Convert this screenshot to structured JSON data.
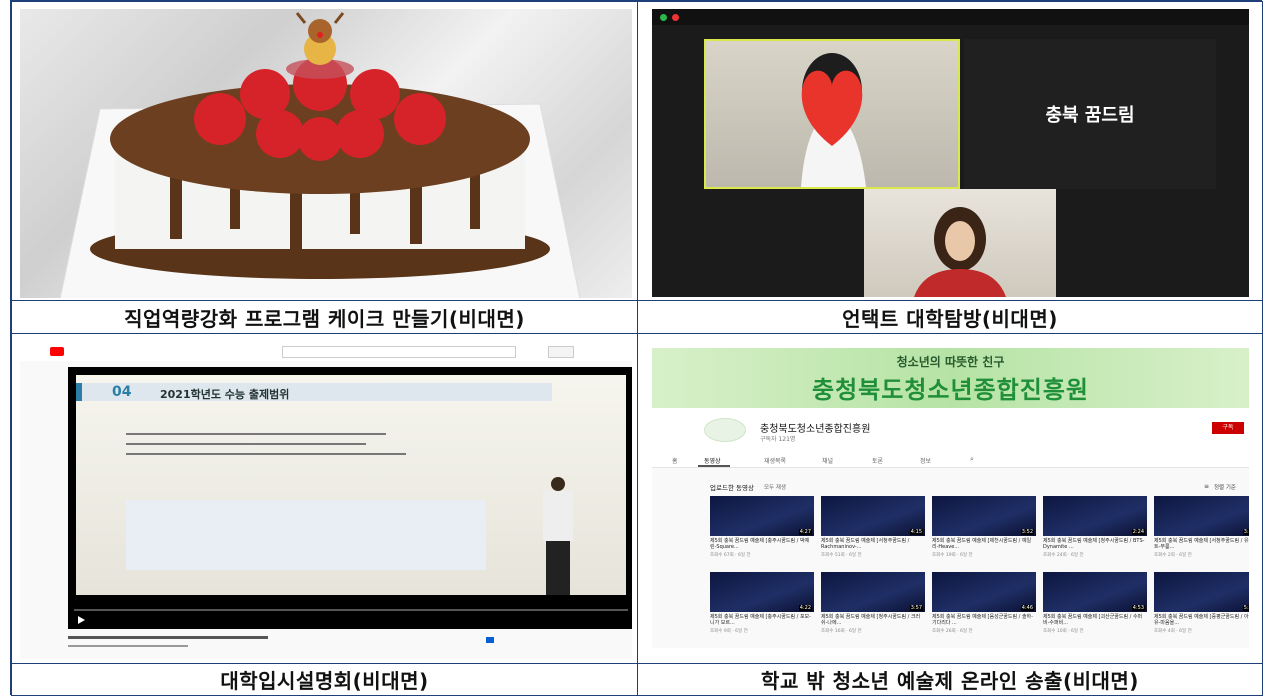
{
  "captions": {
    "top_left": "직업역량강화 프로그램 케이크 만들기(비대면)",
    "top_right": "언택트 대학탐방(비대면)",
    "bottom_left": "대학입시설명회(비대면)",
    "bottom_right": "학교 밖 청소년 예술제 온라인 송출(비대면)"
  },
  "zoom": {
    "participant_name": "충북 꿈드림"
  },
  "youtube": {
    "slide_number": "04",
    "slide_title": "2021학년도 수능 출제범위"
  },
  "site": {
    "banner_subtitle": "청소년의 따뜻한 친구",
    "banner_title": "충청북도청소년종합진흥원",
    "channel_name": "충청북도청소년종합진흥원",
    "subscribers": "구독자 121명",
    "subscribe_label": "구독",
    "tabs": [
      "홈",
      "동영상",
      "재생목록",
      "채널",
      "토론",
      "정보"
    ],
    "section_title": "업로드한 동영상",
    "play_all": "모두 재생",
    "sort_label": "정렬 기준",
    "videos": [
      {
        "title": "제5회 충북 꿈드림 예술제 [충주시꿈드림 / 박예린-Square...",
        "meta": "조회수 67회 · 6일 전",
        "length": "4:27"
      },
      {
        "title": "제5회 충북 꿈드림 예술제 [서청주꿈드림 / Rachmaninov-...",
        "meta": "조회수 51회 · 6일 전",
        "length": "4:15"
      },
      {
        "title": "제5회 충북 꿈드림 예술제 [제천시꿈드림 / 예일리-Heave...",
        "meta": "조회수 19회 · 6일 전",
        "length": "3:52"
      },
      {
        "title": "제5회 충북 꿈드림 예술제 [청주시꿈드림 / BTS-Dynamite ...",
        "meta": "조회수 24회 · 6일 전",
        "length": "2:24"
      },
      {
        "title": "제5회 충북 꿈드림 예술제 [서청주꿈드림 / 유인우트-무릎...",
        "meta": "조회수 2회 · 6일 전",
        "length": "3:37"
      },
      {
        "title": "제5회 충북 꿈드림 예술제 [충주시꿈드림 / 포모-니가 모르...",
        "meta": "조회수 9회 · 6일 전",
        "length": "4:22"
      },
      {
        "title": "제5회 충북 꿈드림 예술제 [청주시꿈드림 / 크러쉬-나에...",
        "meta": "조회수 16회 · 6일 전",
        "length": "3:57"
      },
      {
        "title": "제5회 충북 꿈드림 예술제 [음성군꿈드림 / 솔하-기다리다 ...",
        "meta": "조회수 26회 · 6일 전",
        "length": "4:46"
      },
      {
        "title": "제5회 충북 꿈드림 예술제 [괴산군꿈드림 / 수퍼비-수퍼비...",
        "meta": "조회수 10회 · 6일 전",
        "length": "4:53"
      },
      {
        "title": "제5회 충북 꿈드림 예술제 [증평군꿈드림 / 아이유-마음을...",
        "meta": "조회수 4회 · 6일 전",
        "length": "5:28"
      }
    ]
  }
}
